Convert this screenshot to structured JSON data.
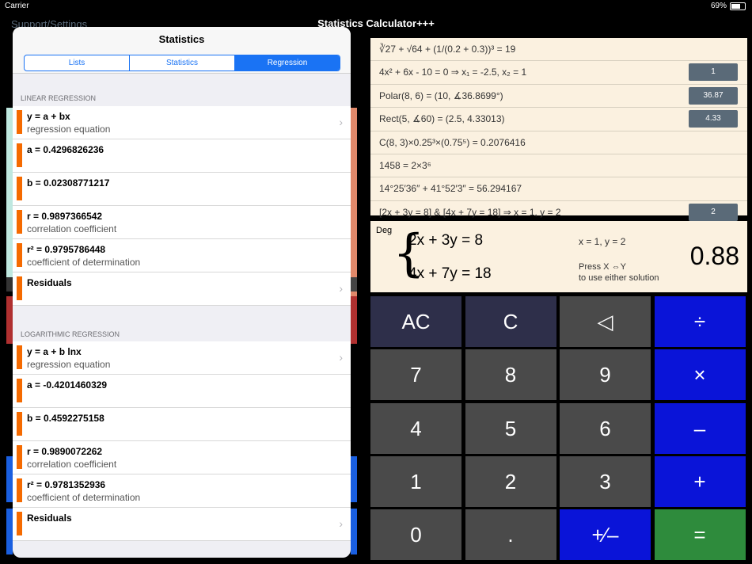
{
  "status": {
    "carrier": "Carrier",
    "battery": "69%"
  },
  "nav": {
    "left": "Support/Settings",
    "title": "Statistics Calculator+++"
  },
  "popover": {
    "title": "Statistics",
    "tabs": [
      "Lists",
      "Statistics",
      "Regression"
    ],
    "linear": {
      "header": "LINEAR REGRESSION",
      "rows": [
        {
          "main": "y = a + bx",
          "sub": "regression equation",
          "chevron": true
        },
        {
          "main": "a = 0.4296826236",
          "sub": "",
          "chevron": false
        },
        {
          "main": "b = 0.02308771217",
          "sub": "",
          "chevron": false
        },
        {
          "main": "r = 0.9897366542",
          "sub": "correlation coefficient",
          "chevron": false
        },
        {
          "main": "r² = 0.9795786448",
          "sub": "coefficient of determination",
          "chevron": false
        },
        {
          "main": "Residuals",
          "sub": "",
          "chevron": true
        }
      ]
    },
    "log": {
      "header": "LOGARITHMIC REGRESSION",
      "rows": [
        {
          "main": "y = a + b lnx",
          "sub": "regression equation",
          "chevron": true
        },
        {
          "main": "a = -0.4201460329",
          "sub": "",
          "chevron": false
        },
        {
          "main": "b = 0.4592275158",
          "sub": "",
          "chevron": false
        },
        {
          "main": "r = 0.9890072262",
          "sub": "correlation coefficient",
          "chevron": false
        },
        {
          "main": "r² = 0.9781352936",
          "sub": "coefficient of determination",
          "chevron": false
        },
        {
          "main": "Residuals",
          "sub": "",
          "chevron": true
        }
      ]
    }
  },
  "history": [
    {
      "text": "∛27 + √64 + (1/(0.2 + 0.3))³ = 19",
      "btn": ""
    },
    {
      "text": "4x² + 6x - 10 = 0     ⇒     x₁ = -2.5, x₂ = 1",
      "btn": "1"
    },
    {
      "text": "Polar(8, 6) = (10, ∡36.8699°)",
      "btn": "36.87"
    },
    {
      "text": "Rect(5, ∡60) = (2.5, 4.33013)",
      "btn": "4.33"
    },
    {
      "text": "C(8, 3)×0.25³×(0.75⁵) = 0.2076416",
      "btn": ""
    },
    {
      "text": "1458 = 2×3⁶",
      "btn": ""
    },
    {
      "text": "14°25′36″ + 41°52′3″ = 56.294167",
      "btn": ""
    },
    {
      "text": "[2x + 3y = 8]  &  [4x + 7y = 18] ⇒ x = 1, y = 2",
      "btn": "2"
    }
  ],
  "display": {
    "mode": "Deg",
    "eq1": "2x + 3y = 8",
    "eq2": "4x + 7y = 18",
    "solution": "x = 1, y = 2",
    "hint1": "Press X ⇔Y",
    "hint2": "to use either solution",
    "value": "0.88"
  },
  "keys": [
    {
      "label": "AC",
      "style": "k-dark",
      "name": "key-ac"
    },
    {
      "label": "C",
      "style": "k-dark",
      "name": "key-c"
    },
    {
      "label": "◁",
      "style": "k-gray",
      "name": "key-backspace"
    },
    {
      "label": "÷",
      "style": "k-blue",
      "name": "key-divide"
    },
    {
      "label": "7",
      "style": "k-gray",
      "name": "key-7"
    },
    {
      "label": "8",
      "style": "k-gray",
      "name": "key-8"
    },
    {
      "label": "9",
      "style": "k-gray",
      "name": "key-9"
    },
    {
      "label": "×",
      "style": "k-blue",
      "name": "key-multiply"
    },
    {
      "label": "4",
      "style": "k-gray",
      "name": "key-4"
    },
    {
      "label": "5",
      "style": "k-gray",
      "name": "key-5"
    },
    {
      "label": "6",
      "style": "k-gray",
      "name": "key-6"
    },
    {
      "label": "–",
      "style": "k-blue",
      "name": "key-minus"
    },
    {
      "label": "1",
      "style": "k-gray",
      "name": "key-1"
    },
    {
      "label": "2",
      "style": "k-gray",
      "name": "key-2"
    },
    {
      "label": "3",
      "style": "k-gray",
      "name": "key-3"
    },
    {
      "label": "+",
      "style": "k-blue",
      "name": "key-plus"
    },
    {
      "label": "0",
      "style": "k-gray",
      "name": "key-0"
    },
    {
      "label": ".",
      "style": "k-gray",
      "name": "key-decimal"
    },
    {
      "label": "+∕–",
      "style": "k-blue",
      "name": "key-negate"
    },
    {
      "label": "=",
      "style": "k-green",
      "name": "key-equals"
    }
  ],
  "colors": {
    "accent": "#1a73f4",
    "row_bar": "#f56a00",
    "paper": "#fbf1e0",
    "key_blue": "#0a14d8",
    "key_green": "#2e8b3c"
  }
}
